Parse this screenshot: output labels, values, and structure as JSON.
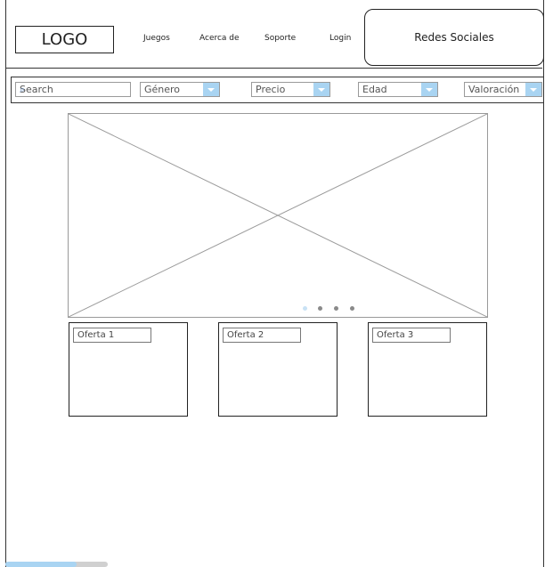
{
  "header": {
    "logo": "LOGO",
    "nav": [
      "Juegos",
      "Acerca de",
      "Soporte",
      "Login"
    ],
    "social": "Redes Sociales"
  },
  "filters": {
    "search_placeholder": "Search",
    "genre": "Género",
    "price": "Precio",
    "age": "Edad",
    "rating": "Valoración"
  },
  "carousel": {
    "slides": 4,
    "active_slide": 1
  },
  "offers": [
    "Oferta 1",
    "Oferta 2",
    "Oferta 3"
  ],
  "colors": {
    "accent": "#a9d4f2",
    "border": "#333333"
  }
}
